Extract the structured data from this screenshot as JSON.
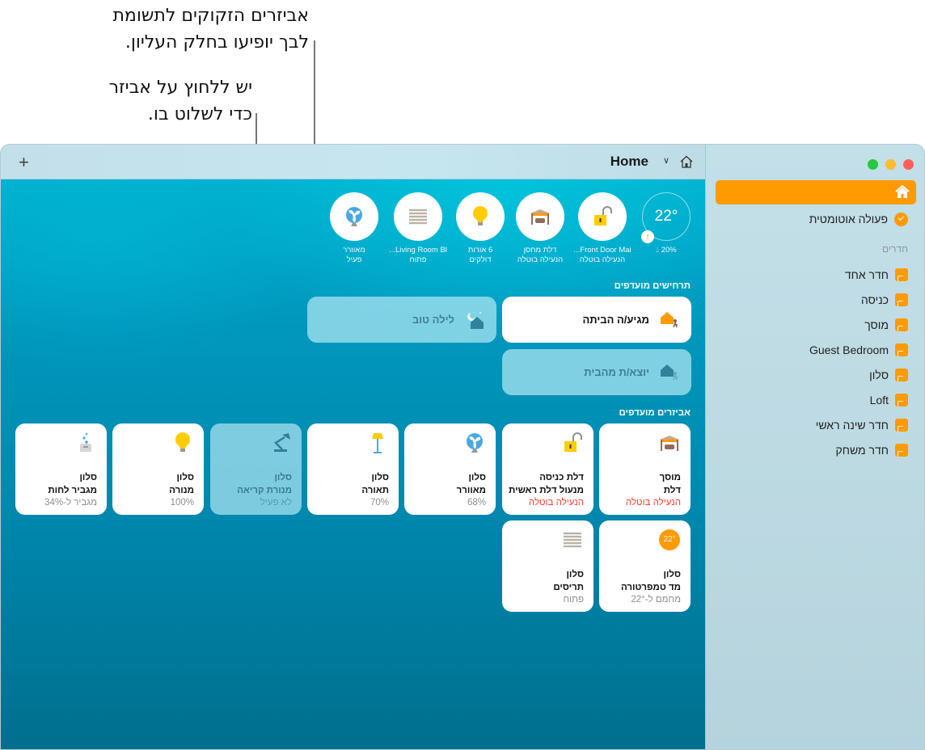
{
  "callouts": {
    "top": [
      "אביזרים הזקוקים לתשומת",
      "לבך יופיעו בחלק העליון."
    ],
    "accessory": [
      "יש ללחוץ על אביזר",
      "כדי לשלוט בו."
    ]
  },
  "toolbar": {
    "add_label": "+",
    "home_name": "Home",
    "chevron": "⌄"
  },
  "status_bar": {
    "climate": {
      "temperature": "22°",
      "humidity": "20%",
      "trend_icon": "arrow-up"
    },
    "items": [
      {
        "icon": "lock-open",
        "line1": "Front Door Mai...",
        "line2": "הנעילה בוטלה"
      },
      {
        "icon": "garage",
        "line1": "דלת מחסן",
        "line2": "הנעילה בוטלה"
      },
      {
        "icon": "lightbulb",
        "line1": "6 אורות",
        "line2": "דולקים"
      },
      {
        "icon": "blinds",
        "line1": "Living Room Bl...",
        "line2": "פתוח"
      },
      {
        "icon": "fan",
        "line1": "מאוורר",
        "line2": "פעיל"
      }
    ]
  },
  "scenes": {
    "title": "תרחישים מועדפים",
    "items": [
      {
        "label": "מגיע/ה הביתה",
        "icon": "arrive-home",
        "active": true
      },
      {
        "label": "לילה טוב",
        "icon": "good-night",
        "active": false
      },
      {
        "label": "יוצא/ת מהבית",
        "icon": "leave-home",
        "active": false
      }
    ]
  },
  "accessories": {
    "title": "אביזרים מועדפים",
    "items": [
      {
        "room": "מוסך",
        "name": "דלת",
        "status": "הנעילה בוטלה",
        "alert": true,
        "icon": "garage",
        "on": true
      },
      {
        "room": "דלת כניסה",
        "name": "מנעול דלת ראשית",
        "status": "הנעילה בוטלה",
        "alert": true,
        "icon": "lock-open",
        "on": true
      },
      {
        "room": "סלון",
        "name": "מאוורר",
        "status": "68%",
        "alert": false,
        "icon": "fan",
        "on": true
      },
      {
        "room": "סלון",
        "name": "תאורה",
        "status": "70%",
        "alert": false,
        "icon": "floor-lamp",
        "on": true
      },
      {
        "room": "סלון",
        "name": "מנורת קריאה",
        "status": "לא פעיל",
        "alert": false,
        "icon": "desk-lamp",
        "on": false
      },
      {
        "room": "סלון",
        "name": "מנורה",
        "status": "100%",
        "alert": false,
        "icon": "lightbulb",
        "on": true
      },
      {
        "room": "סלון",
        "name": "מגביר לחות",
        "status": "מגביר ל-34%",
        "alert": false,
        "icon": "humidifier",
        "on": true
      },
      {
        "room": "סלון",
        "name": "מד טמפרטורה",
        "status": "מחמם ל-22°",
        "alert": false,
        "icon": "thermostat",
        "badge": "22°",
        "on": true
      },
      {
        "room": "סלון",
        "name": "תריסים",
        "status": "פתוח",
        "alert": false,
        "icon": "blinds",
        "on": true
      }
    ]
  },
  "sidebar": {
    "home_icon": "house",
    "automation_label": "פעולה אוטומטית",
    "rooms_title": "חדרים",
    "rooms": [
      "חדר אחד",
      "כניסה",
      "מוסך",
      "Guest Bedroom",
      "סלון",
      "Loft",
      "חדר שינה ראשי",
      "חדר משחק"
    ]
  },
  "colors": {
    "accent": "#ff9a00",
    "alert": "#ff3b30",
    "close": "#ff5f57",
    "minimize": "#febc2e",
    "zoom": "#28c840"
  }
}
